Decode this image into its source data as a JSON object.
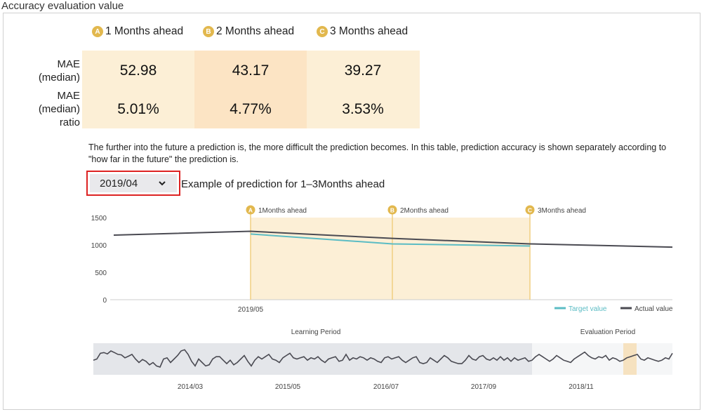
{
  "title": "Accuracy evaluation value",
  "horizons": [
    {
      "badge": "A",
      "label": "1 Months ahead"
    },
    {
      "badge": "B",
      "label": "2 Months ahead"
    },
    {
      "badge": "C",
      "label": "3 Months ahead"
    }
  ],
  "metrics": [
    {
      "label_lines": [
        "MAE",
        "(median)"
      ],
      "values": [
        "52.98",
        "43.17",
        "39.27"
      ]
    },
    {
      "label_lines": [
        "MAE",
        "(median)",
        "ratio"
      ],
      "values": [
        "5.01%",
        "4.77%",
        "3.53%"
      ]
    }
  ],
  "description": "The further into the future a prediction is, the more difficult the prediction becomes. In this table, prediction accuracy is shown separately according to \"how far in the future\" the prediction is.",
  "dropdown": {
    "selected": "2019/04"
  },
  "example_label": "Example of prediction for 1–3Months ahead",
  "colors": {
    "target": "#5bbcc4",
    "actual": "#4a4a52",
    "highlight": "#fcefd6",
    "badge": "#e2b84e",
    "dropdown_border": "#dd2222"
  },
  "chart_data": [
    {
      "type": "line",
      "ylim": [
        0,
        1500
      ],
      "yticks": [
        "0",
        "500",
        "1000",
        "1500"
      ],
      "x_label": "2019/05",
      "markers": [
        {
          "badge": "A",
          "label": "1Months ahead"
        },
        {
          "badge": "B",
          "label": "2Months ahead"
        },
        {
          "badge": "C",
          "label": "3Months ahead"
        }
      ],
      "series": [
        {
          "name": "Target value",
          "color": "#5bbcc4",
          "values": [
            1200,
            1020,
            980
          ]
        },
        {
          "name": "Actual value",
          "color": "#4a4a52",
          "values": [
            1180,
            1250,
            1120,
            1020,
            960
          ]
        }
      ],
      "legend": {
        "position": "bottom-right",
        "items": [
          "Target value",
          "Actual value"
        ]
      }
    },
    {
      "type": "line",
      "period_labels": [
        "Learning Period",
        "Evaluation Period"
      ],
      "x_ticks": [
        "2014/03",
        "2015/05",
        "2016/07",
        "2017/09",
        "2018/11"
      ],
      "series": [
        {
          "name": "Actual value",
          "values": [
            0.45,
            0.5,
            0.75,
            0.78,
            0.72,
            0.85,
            0.78,
            0.7,
            0.68,
            0.55,
            0.62,
            0.7,
            0.5,
            0.35,
            0.48,
            0.4,
            0.25,
            0.35,
            0.2,
            0.15,
            0.5,
            0.55,
            0.35,
            0.5,
            0.65,
            0.85,
            0.9,
            0.7,
            0.4,
            0.2,
            0.5,
            0.35,
            0.2,
            0.25,
            0.5,
            0.6,
            0.6,
            0.45,
            0.3,
            0.45,
            0.25,
            0.35,
            0.5,
            0.65,
            0.4,
            0.2,
            0.45,
            0.6,
            0.5,
            0.6,
            0.7,
            0.5,
            0.45,
            0.35,
            0.55,
            0.65,
            0.75,
            0.55,
            0.5,
            0.55,
            0.6,
            0.45,
            0.55,
            0.5,
            0.6,
            0.45,
            0.35,
            0.5,
            0.55,
            0.6,
            0.4,
            0.45,
            0.7,
            0.45,
            0.55,
            0.5,
            0.6,
            0.55,
            0.45,
            0.55,
            0.5,
            0.4,
            0.35,
            0.55,
            0.6,
            0.5,
            0.55,
            0.6,
            0.45,
            0.35,
            0.45,
            0.55,
            0.6,
            0.35,
            0.3,
            0.35,
            0.55,
            0.45,
            0.35,
            0.5,
            0.65,
            0.55,
            0.4,
            0.35,
            0.3,
            0.3,
            0.45,
            0.65,
            0.5,
            0.45,
            0.6,
            0.65,
            0.5,
            0.45,
            0.55,
            0.45,
            0.6,
            0.45,
            0.55,
            0.4,
            0.55,
            0.45,
            0.5,
            0.55,
            0.4,
            0.45,
            0.6,
            0.7,
            0.6,
            0.5,
            0.4,
            0.5,
            0.65,
            0.55,
            0.45,
            0.4,
            0.35,
            0.5,
            0.6,
            0.7,
            0.8,
            0.65,
            0.55,
            0.5,
            0.6,
            0.55,
            0.65,
            0.45,
            0.55,
            0.5,
            0.4,
            0.45,
            0.55,
            0.6,
            0.65,
            0.7,
            0.5,
            0.45,
            0.55,
            0.5,
            0.45,
            0.4,
            0.45,
            0.55,
            0.5,
            0.75
          ]
        }
      ]
    }
  ]
}
